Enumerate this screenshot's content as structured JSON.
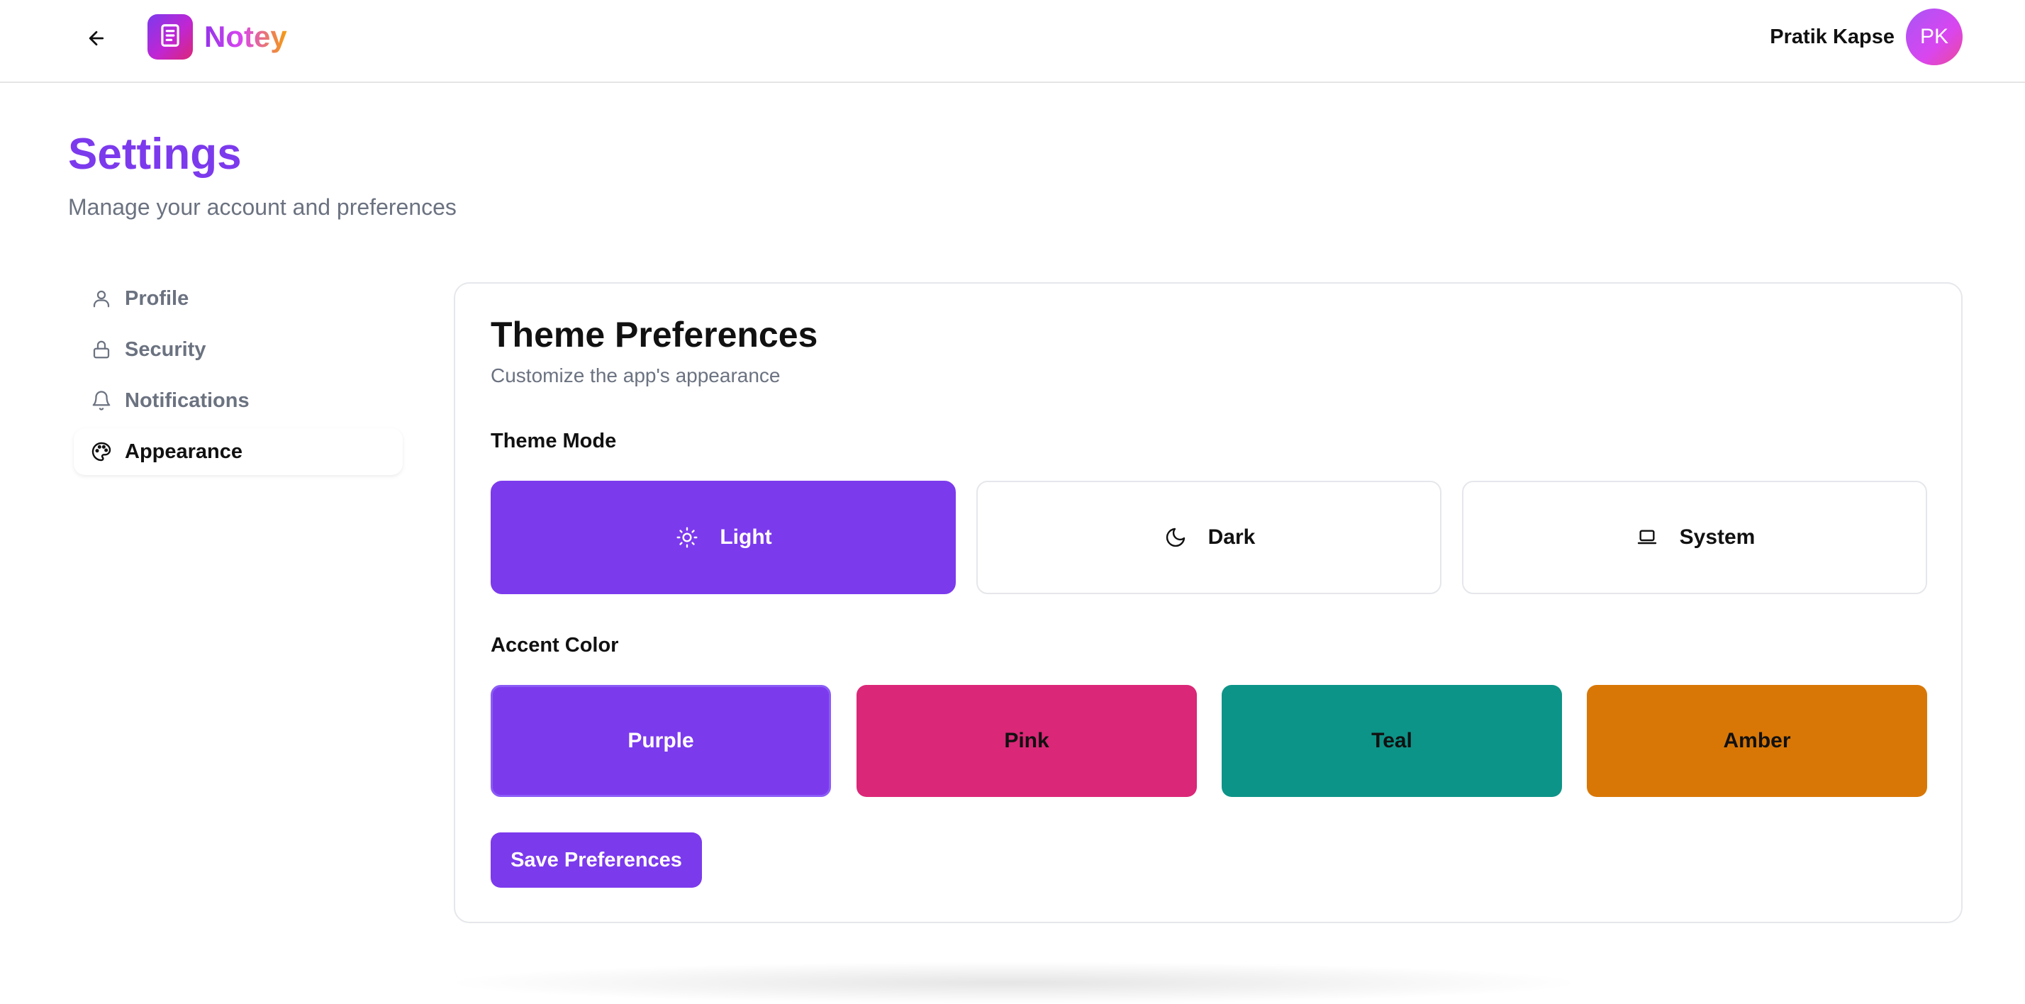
{
  "header": {
    "app_name": "Notey",
    "user_name": "Pratik Kapse",
    "avatar_initials": "PK",
    "icons": {
      "back": "arrow-left-icon",
      "logo": "notebook-icon"
    }
  },
  "page": {
    "title": "Settings",
    "subtitle": "Manage your account and preferences"
  },
  "sidebar": {
    "items": [
      {
        "label": "Profile",
        "icon": "user-icon",
        "active": false
      },
      {
        "label": "Security",
        "icon": "lock-icon",
        "active": false
      },
      {
        "label": "Notifications",
        "icon": "bell-icon",
        "active": false
      },
      {
        "label": "Appearance",
        "icon": "palette-icon",
        "active": true
      }
    ]
  },
  "card": {
    "title": "Theme Preferences",
    "subtitle": "Customize the app's appearance",
    "theme_mode": {
      "label": "Theme Mode",
      "selected": "Light",
      "options": [
        {
          "label": "Light",
          "icon": "sun-icon"
        },
        {
          "label": "Dark",
          "icon": "moon-icon"
        },
        {
          "label": "System",
          "icon": "laptop-icon"
        }
      ]
    },
    "accent_color": {
      "label": "Accent Color",
      "selected": "Purple",
      "options": [
        {
          "label": "Purple",
          "color": "#7c3aed"
        },
        {
          "label": "Pink",
          "color": "#db2777"
        },
        {
          "label": "Teal",
          "color": "#0d9488"
        },
        {
          "label": "Amber",
          "color": "#d97706"
        }
      ]
    },
    "save_label": "Save Preferences"
  },
  "colors": {
    "primary": "#7c3aed",
    "muted_text": "#6b7280",
    "border": "#e5e7eb"
  }
}
